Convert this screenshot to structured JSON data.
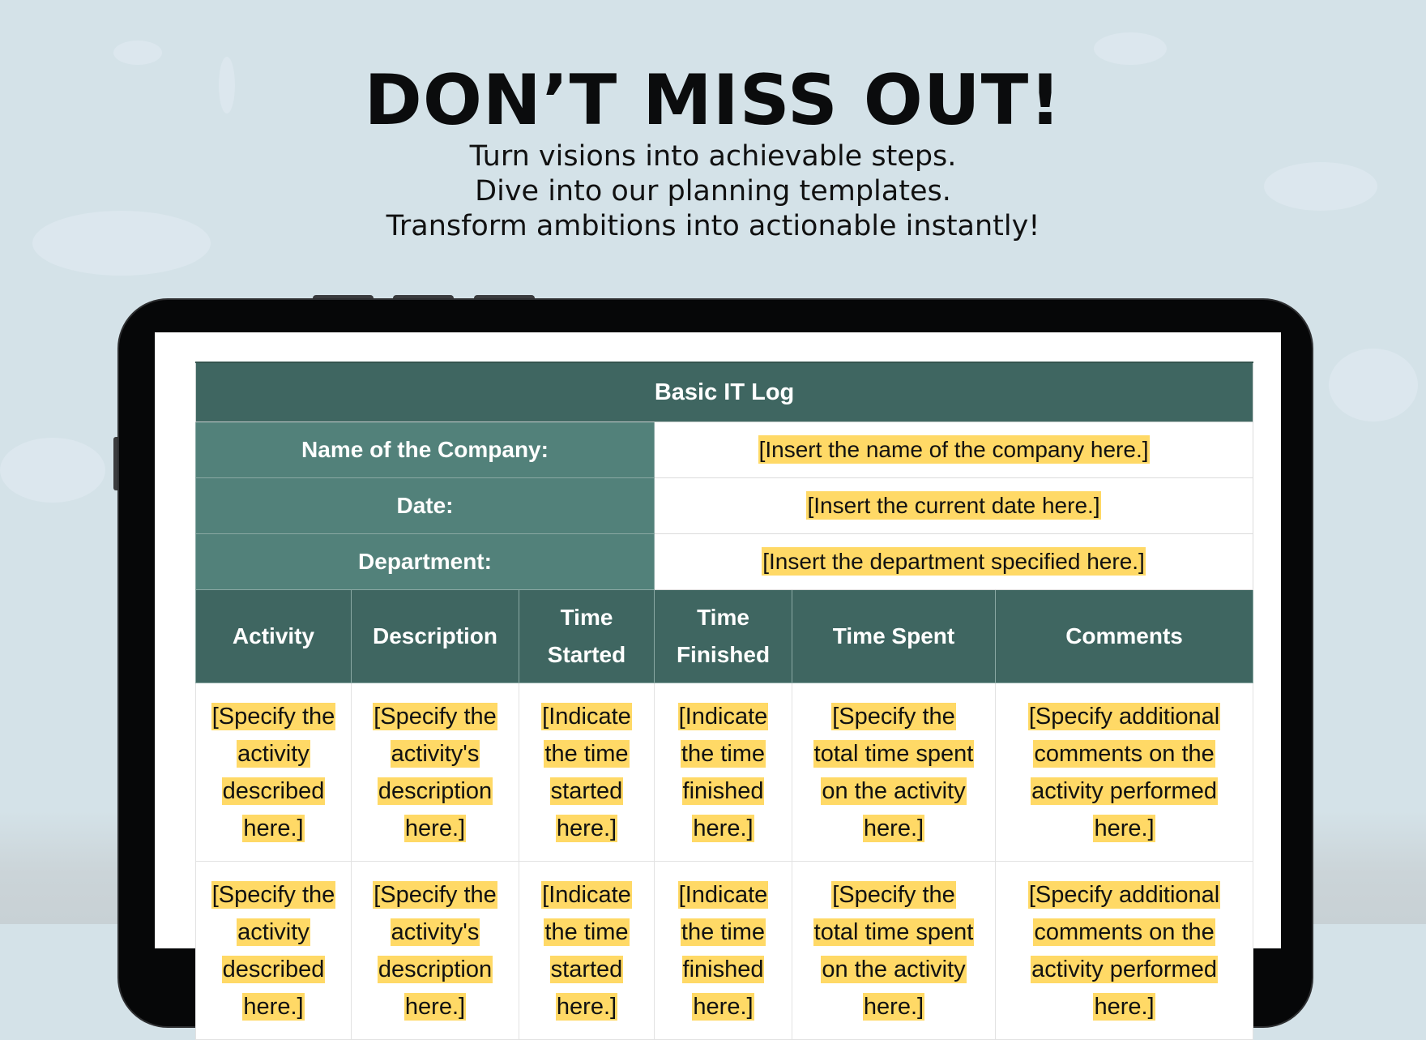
{
  "promo": {
    "headline": "DON’T MISS OUT!",
    "subtitle_lines": [
      "Turn visions into achievable steps.",
      "Dive into our planning templates.",
      "Transform ambitions into actionable instantly!"
    ]
  },
  "colors": {
    "header_dark": "#3f6661",
    "label_green": "#52817a",
    "highlight": "#ffd966",
    "background": "#d4e2e8",
    "tablet_frame": "#060708"
  },
  "document": {
    "title": "Basic IT Log",
    "info_rows": [
      {
        "label": "Name of the Company:",
        "value": "[Insert the name of the company here.]"
      },
      {
        "label": "Date:",
        "value": "[Insert the current date here.]"
      },
      {
        "label": "Department:",
        "value": "[Insert the department specified here.]"
      }
    ],
    "columns": [
      {
        "lines": [
          "Activity"
        ]
      },
      {
        "lines": [
          "Description"
        ]
      },
      {
        "lines": [
          "Time",
          "Started"
        ]
      },
      {
        "lines": [
          "Time",
          "Finished"
        ]
      },
      {
        "lines": [
          "Time Spent"
        ]
      },
      {
        "lines": [
          "Comments"
        ]
      }
    ],
    "rows": [
      {
        "cells": [
          {
            "lines": [
              "[Specify the",
              "activity",
              "described",
              "here.]"
            ]
          },
          {
            "lines": [
              "[Specify the",
              "activity's",
              "description",
              "here.]"
            ]
          },
          {
            "lines": [
              "[Indicate",
              "the time",
              "started",
              "here.]"
            ]
          },
          {
            "lines": [
              "[Indicate",
              "the time",
              "finished",
              "here.]"
            ]
          },
          {
            "lines": [
              "[Specify the",
              "total time spent",
              "on the activity",
              "here.]"
            ]
          },
          {
            "lines": [
              "[Specify additional",
              "comments on the",
              "activity performed",
              "here.]"
            ]
          }
        ]
      },
      {
        "cells": [
          {
            "lines": [
              "[Specify the",
              "activity",
              "described",
              "here.]"
            ]
          },
          {
            "lines": [
              "[Specify the",
              "activity's",
              "description",
              "here.]"
            ]
          },
          {
            "lines": [
              "[Indicate",
              "the time",
              "started",
              "here.]"
            ]
          },
          {
            "lines": [
              "[Indicate",
              "the time",
              "finished",
              "here.]"
            ]
          },
          {
            "lines": [
              "[Specify the",
              "total time spent",
              "on the activity",
              "here.]"
            ]
          },
          {
            "lines": [
              "[Specify additional",
              "comments on the",
              "activity performed",
              "here.]"
            ]
          }
        ]
      }
    ]
  }
}
